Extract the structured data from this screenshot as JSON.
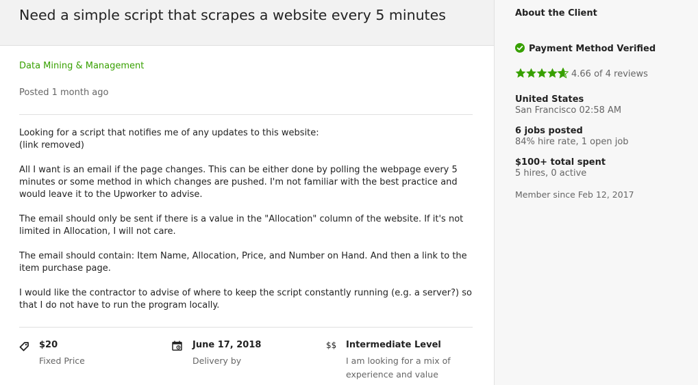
{
  "job": {
    "title": "Need a simple script that scrapes a website every 5 minutes",
    "category": "Data Mining & Management",
    "posted": "Posted 1 month ago",
    "description": [
      "Looking for a script that notifies me of any updates to this website:",
      "(link removed)",
      "All I want is an email if the page changes. This can be either done by polling the webpage every 5 minutes or some method in which changes are pushed. I'm not familiar with the best practice and would leave it to the Upworker to advise.",
      "The email should only be sent if there is a value in the \"Allocation\" column of the website. If it's not limited in Allocation, I will not care.",
      "The email should contain: Item Name, Allocation, Price, and Number on Hand. And then a link to the item purchase page.",
      "I would like the contractor to advise of where to keep the script constantly running (e.g. a server?) so that I do not have to run the program locally."
    ],
    "features": {
      "price": {
        "icon": "price-tag-icon",
        "value": "$20",
        "label": "Fixed Price"
      },
      "delivery": {
        "icon": "calendar-icon",
        "value": "June 17, 2018",
        "label": "Delivery by"
      },
      "level": {
        "icon": "dollar-signs-icon",
        "icon_text": "$$",
        "value": "Intermediate Level",
        "label": "I am looking for a mix of experience and value"
      }
    }
  },
  "client": {
    "heading": "About the Client",
    "payment_verified": "Payment Method Verified",
    "rating": {
      "stars": 4.66,
      "text": "4.66 of 4 reviews"
    },
    "location": {
      "country": "United States",
      "city_time": "San Francisco 02:58 AM"
    },
    "jobs": {
      "posted": "6 jobs posted",
      "detail": "84% hire rate, 1 open job"
    },
    "spent": {
      "total": "$100+ total spent",
      "detail": "5 hires, 0 active"
    },
    "member_since": "Member since Feb 12, 2017"
  },
  "colors": {
    "accent_green": "#37a000",
    "star_green": "#37a000",
    "text_dark": "#222222",
    "text_muted": "#656565"
  }
}
